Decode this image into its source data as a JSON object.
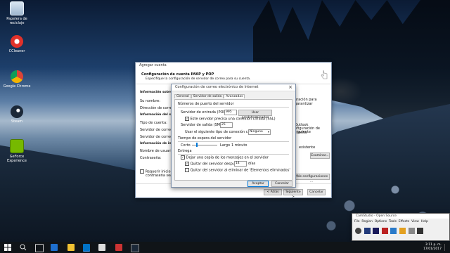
{
  "desktop": {
    "icons": [
      {
        "label": "Papelera de reciclaje",
        "icon": "recycle-bin-icon"
      },
      {
        "label": "CCleaner",
        "icon": "ccleaner-icon"
      },
      {
        "label": "Google Chrome",
        "icon": "chrome-icon"
      },
      {
        "label": "Steam",
        "icon": "steam-icon"
      },
      {
        "label": "GeForce Experience",
        "icon": "geforce-icon"
      }
    ]
  },
  "bg_window": {
    "title": "Agregar cuenta",
    "heading": "Configuración de cuenta IMAP y POP",
    "subheading": "Especifique la configuración de servidor de correo para su cuenta.",
    "sections": {
      "info_user": "Información sobre el",
      "info_server": "Información del servid",
      "info_login": "Información de inicio"
    },
    "labels": {
      "name": "Su nombre:",
      "email": "Dirección de correo e",
      "account_type": "Tipo de cuenta:",
      "incoming": "Servidor de correo en",
      "outgoing": "Servidor de correo sa",
      "username": "Nombre de usuario:",
      "password": "Contraseña:",
      "require_line1": "Requerir inicio de",
      "require_line2": "contraseña segura"
    },
    "right": {
      "save_text": "uración para garantizar",
      "next_text": "nfiguración de cuenta",
      "next_text2": "siguiente",
      "deliver_text": "existente",
      "outlook": "Outlook"
    },
    "buttons": {
      "probar": "",
      "explorar": "Examinar...",
      "more_settings": "Más configuraciones ...",
      "back": "< Atrás",
      "next": "Siguiente >",
      "cancel": "Cancelar"
    }
  },
  "dialog": {
    "title": "Configuración de correo electrónico de Internet",
    "tabs": [
      "General",
      "Servidor de salida",
      "Avanzadas"
    ],
    "ports_group": "Números de puerto del servidor",
    "incoming_label": "Servidor de entrada (POP3):",
    "incoming_value": "995",
    "defaults_button": "Usar predeterminados",
    "ssl_label": "Este servidor precisa una conexión cifrada (SSL)",
    "ssl_checked": true,
    "outgoing_label": "Servidor de salida (SMTP):",
    "outgoing_value": "25",
    "encrypt_label": "Usar el siguiente tipo de conexión cifrada:",
    "encrypt_value": "Ninguno",
    "timeout_group": "Tiempo de espera del servidor",
    "timeout_short": "Corto",
    "timeout_long": "Largo",
    "timeout_value": "1 minuto",
    "delivery_group": "Entrega",
    "keep_copy": "Dejar una copia de los mensajes en el servidor",
    "keep_copy_checked": true,
    "remove_after": "Quitar del servidor después",
    "remove_after_checked": true,
    "remove_days": "14",
    "days_label": "días",
    "remove_deleted": "Quitar del servidor al eliminar de 'Elementos eliminados'",
    "remove_deleted_checked": false,
    "ok": "Aceptar",
    "cancel": "Cancelar",
    "close_glyph": "×"
  },
  "camstudio": {
    "title": "CamStudio - Open Source",
    "menu": [
      "File",
      "Region",
      "Options",
      "Tools",
      "Effects",
      "View",
      "Help"
    ]
  },
  "taskbar": {
    "time": "3:11 p. m.",
    "date": "17/01/2017"
  },
  "colors": {
    "accent": "#0078d7",
    "taskbar": "#101418"
  }
}
